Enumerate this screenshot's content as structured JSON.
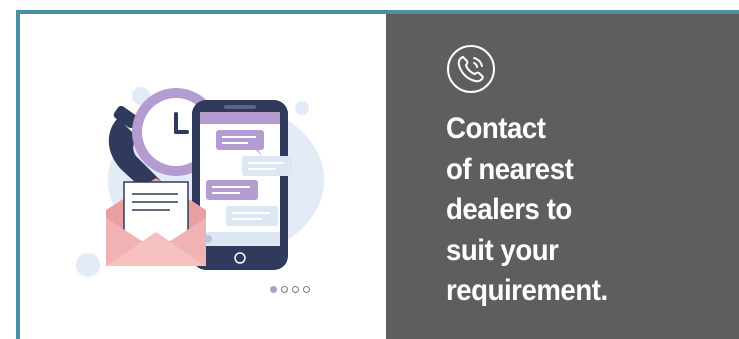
{
  "panel": {
    "headline_lines": [
      "Contact",
      "of nearest",
      "dealers to",
      "suit your",
      "requirement."
    ],
    "icon": "phone-call-icon"
  },
  "illustration": {
    "icons": [
      "clock-icon",
      "telephone-handset-icon",
      "smartphone-icon",
      "chat-bubble-icon",
      "envelope-icon",
      "letter-icon"
    ]
  },
  "carousel": {
    "slide_count": 4,
    "active_index": 0
  },
  "colors": {
    "accent_border": "#4a8fa3",
    "panel_bg": "#5e5e60",
    "text": "#ffffff",
    "lavender": "#b49bd0",
    "navy": "#2f3a5c",
    "pink": "#f0a6a6",
    "light_blue": "#dde7f4"
  }
}
